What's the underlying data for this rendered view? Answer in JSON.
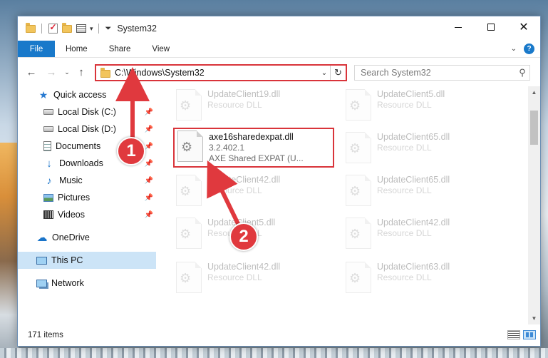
{
  "window": {
    "title": "System32"
  },
  "ribbon": {
    "file_tab": "File",
    "tabs": [
      "Home",
      "Share",
      "View"
    ],
    "help": "?"
  },
  "address": {
    "path": "C:\\Windows\\System32",
    "search_placeholder": "Search System32"
  },
  "sidebar": {
    "items": [
      {
        "label": "Quick access",
        "icon": "star-icon",
        "pinned": false
      },
      {
        "label": "Local Disk (C:)",
        "icon": "disk-icon",
        "pinned": true
      },
      {
        "label": "Local Disk (D:)",
        "icon": "disk-icon",
        "pinned": true
      },
      {
        "label": "Documents",
        "icon": "document-icon",
        "pinned": true
      },
      {
        "label": "Downloads",
        "icon": "download-icon",
        "pinned": true
      },
      {
        "label": "Music",
        "icon": "music-icon",
        "pinned": true
      },
      {
        "label": "Pictures",
        "icon": "pictures-icon",
        "pinned": true
      },
      {
        "label": "Videos",
        "icon": "video-icon",
        "pinned": true
      },
      {
        "label": "OneDrive",
        "icon": "cloud-icon",
        "pinned": false
      },
      {
        "label": "This PC",
        "icon": "computer-icon",
        "pinned": false,
        "selected": true
      },
      {
        "label": "Network",
        "icon": "network-icon",
        "pinned": false
      }
    ]
  },
  "files": [
    {
      "name": "UpdateClient19.dll",
      "sub": "Resource DLL",
      "faded": true
    },
    {
      "name": "UpdateClient5.dll",
      "sub": "Resource DLL",
      "faded": true
    },
    {
      "name": "axe16sharedexpat.dll",
      "version": "3.2.402.1",
      "description": "AXE Shared EXPAT (U...",
      "faded": false,
      "highlighted": true
    },
    {
      "name": "UpdateClient65.dll",
      "sub": "Resource DLL",
      "faded": true
    },
    {
      "name": "UpdateClient42.dll",
      "sub": "Resource DLL",
      "faded": true
    },
    {
      "name": "UpdateClient65.dll",
      "sub": "Resource DLL",
      "faded": true
    },
    {
      "name": "UpdateClient5.dll",
      "sub": "Resource DLL",
      "faded": true
    },
    {
      "name": "UpdateClient42.dll",
      "sub": "Resource DLL",
      "faded": true
    },
    {
      "name": "UpdateClient42.dll",
      "sub": "Resource DLL",
      "faded": true
    },
    {
      "name": "UpdateClient63.dll",
      "sub": "Resource DLL",
      "faded": true
    }
  ],
  "status": {
    "item_count": "171 items"
  },
  "annotations": {
    "step1": "1",
    "step2": "2",
    "color": "#e0393e"
  }
}
